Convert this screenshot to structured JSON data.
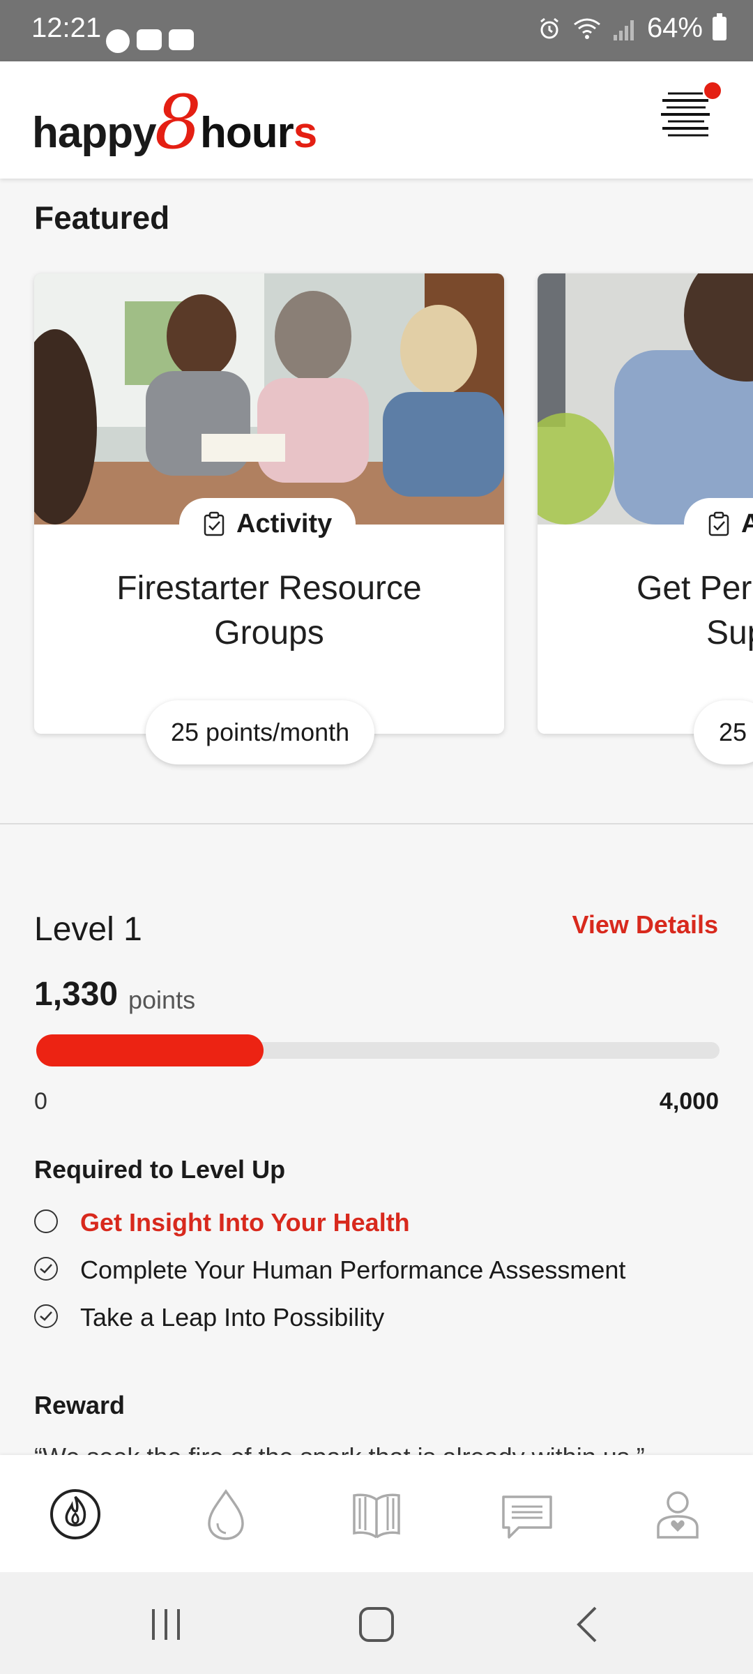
{
  "status_bar": {
    "time": "12:21",
    "battery": "64%"
  },
  "header": {
    "logo": {
      "part1": "happy",
      "part2": "8",
      "part3": "hour",
      "part4": "s"
    },
    "menu_icon": "hamburger-menu-icon",
    "notification_dot_color": "#e41f13"
  },
  "featured": {
    "title": "Featured",
    "cards": [
      {
        "type_label": "Activity",
        "title": "Firestarter Resource Groups",
        "points": "25 points/month"
      },
      {
        "type_label": "A",
        "title_line1": "Get Per",
        "title_line2": "Sup",
        "points": "25"
      }
    ]
  },
  "level": {
    "label": "Level 1",
    "view_details": "View Details",
    "points_value": "1,330",
    "points_unit": "points",
    "progress_fraction": 0.3325,
    "scale_min": "0",
    "scale_max": "4,000"
  },
  "requirements": {
    "title": "Required to Level Up",
    "items": [
      {
        "label": "Get Insight Into Your Health",
        "done": false
      },
      {
        "label": "Complete Your Human Performance Assessment",
        "done": true
      },
      {
        "label": "Take a Leap Into Possibility",
        "done": true
      }
    ]
  },
  "reward": {
    "title": "Reward",
    "quote": "“We seek the fire of the spark that is already within us.”"
  },
  "colors": {
    "accent": "#e41f13",
    "link": "#d8291d"
  },
  "bottom_nav": [
    "flame-icon",
    "drop-icon",
    "book-icon",
    "chat-icon",
    "profile-heart-icon"
  ]
}
